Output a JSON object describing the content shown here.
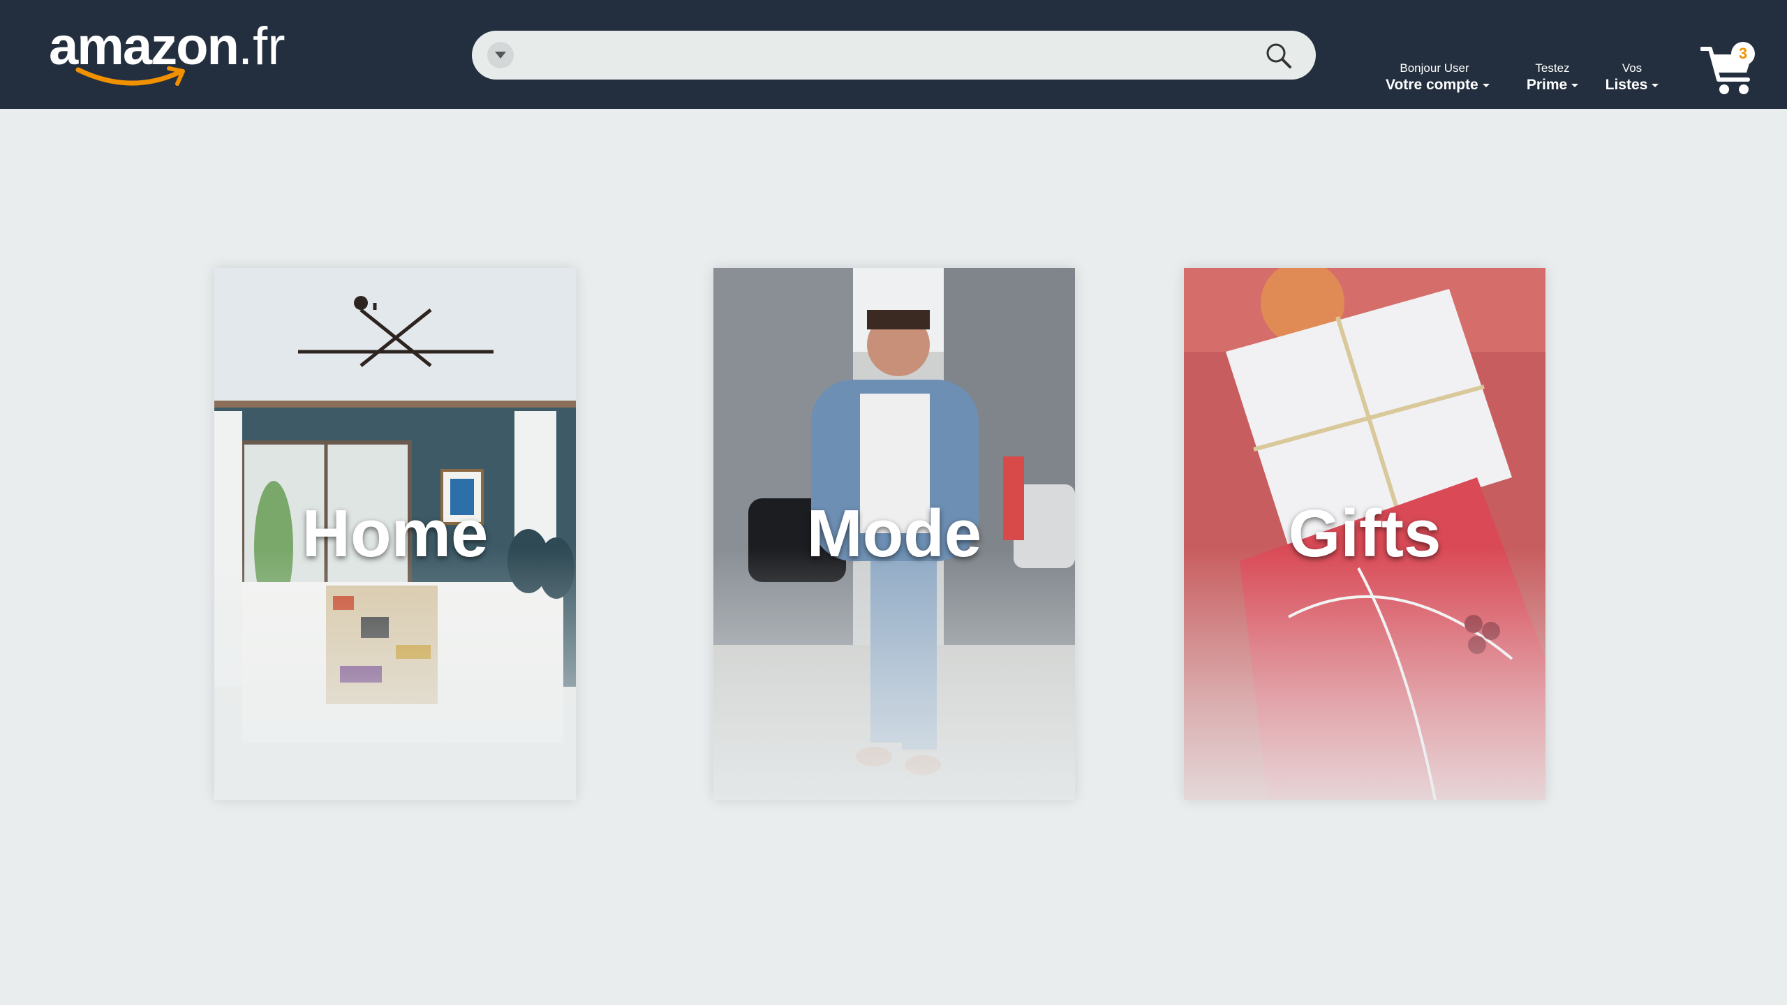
{
  "header": {
    "logo": {
      "brand": "amazon",
      "tld": ".fr"
    },
    "search": {
      "value": "",
      "placeholder": ""
    },
    "account": {
      "line1": "Bonjour User",
      "line2": "Votre compte"
    },
    "prime": {
      "line1": "Testez",
      "line2": "Prime"
    },
    "lists": {
      "line1": "Vos",
      "line2": "Listes"
    },
    "cart": {
      "count": "3"
    }
  },
  "categories": [
    {
      "label": "Home",
      "image": "bedroom-photo"
    },
    {
      "label": "Mode",
      "image": "fashion-street-photo"
    },
    {
      "label": "Gifts",
      "image": "gift-boxes-photo"
    }
  ],
  "colors": {
    "header_bg": "#232f3e",
    "page_bg": "#e9edee",
    "search_bg": "#e7ebea",
    "accent_orange": "#f29100"
  }
}
